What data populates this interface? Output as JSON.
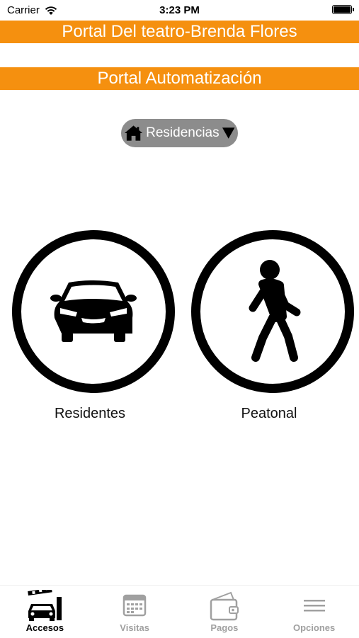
{
  "status_bar": {
    "carrier": "Carrier",
    "time": "3:23 PM",
    "wifi_icon": "wifi-icon",
    "battery_icon": "battery-icon"
  },
  "header": {
    "title": "Portal Del teatro-Brenda Flores",
    "subtitle": "Portal Automatización",
    "accent_color": "#f5900f"
  },
  "selector": {
    "label": "Residencias",
    "icon": "home-icon",
    "caret": "caret-down-icon"
  },
  "options": [
    {
      "label": "Residentes",
      "icon": "car-icon"
    },
    {
      "label": "Peatonal",
      "icon": "pedestrian-icon"
    }
  ],
  "tabs": [
    {
      "label": "Accesos",
      "icon": "gate-car-icon",
      "active": true
    },
    {
      "label": "Visitas",
      "icon": "calendar-icon",
      "active": false
    },
    {
      "label": "Pagos",
      "icon": "wallet-icon",
      "active": false
    },
    {
      "label": "Opciones",
      "icon": "menu-icon",
      "active": false
    }
  ]
}
